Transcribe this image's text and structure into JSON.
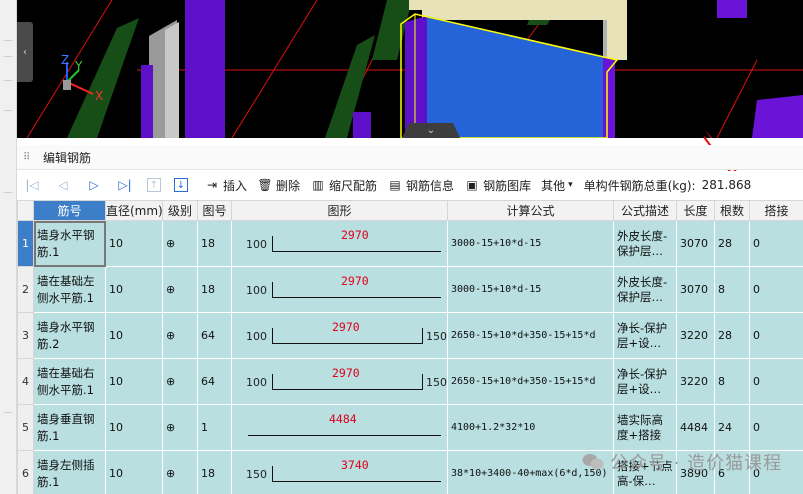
{
  "panel": {
    "title": "编辑钢筋"
  },
  "toolbar": {
    "insert": "插入",
    "delete": "删除",
    "scale_config": "缩尺配筋",
    "rebar_info": "钢筋信息",
    "rebar_library": "钢筋图库",
    "other": "其他",
    "total_label": "单构件钢筋总重(kg):",
    "total_value": "281.868"
  },
  "axes": {
    "x": "X",
    "y": "Y",
    "z": "Z"
  },
  "columns": [
    "筋号",
    "直径(mm)",
    "级别",
    "图号",
    "图形",
    "计算公式",
    "公式描述",
    "长度",
    "根数",
    "搭接"
  ],
  "rows": [
    {
      "no": "1",
      "name": "墙身水平钢筋.1",
      "dia": "10",
      "grade": "⊕",
      "fig": "18",
      "left": "100",
      "mid": "2970",
      "right": "",
      "formula": "3000-15+10*d-15",
      "desc1": "外皮长度-",
      "desc2": "保护层…",
      "len": "3070",
      "count": "28",
      "lap": "0"
    },
    {
      "no": "2",
      "name": "墙在基础左侧水平筋.1",
      "dia": "10",
      "grade": "⊕",
      "fig": "18",
      "left": "100",
      "mid": "2970",
      "right": "",
      "formula": "3000-15+10*d-15",
      "desc1": "外皮长度-",
      "desc2": "保护层…",
      "len": "3070",
      "count": "8",
      "lap": "0"
    },
    {
      "no": "3",
      "name": "墙身水平钢筋.2",
      "dia": "10",
      "grade": "⊕",
      "fig": "64",
      "left": "100",
      "mid": "2970",
      "right": "150",
      "formula": "2650-15+10*d+350-15+15*d",
      "desc1": "净长-保护",
      "desc2": "层+设…",
      "len": "3220",
      "count": "28",
      "lap": "0"
    },
    {
      "no": "4",
      "name": "墙在基础右侧水平筋.1",
      "dia": "10",
      "grade": "⊕",
      "fig": "64",
      "left": "100",
      "mid": "2970",
      "right": "150",
      "formula": "2650-15+10*d+350-15+15*d",
      "desc1": "净长-保护",
      "desc2": "层+设…",
      "len": "3220",
      "count": "8",
      "lap": "0"
    },
    {
      "no": "5",
      "name": "墙身垂直钢筋.1",
      "dia": "10",
      "grade": "⊕",
      "fig": "1",
      "left": "",
      "mid": "4484",
      "right": "",
      "formula": "4100+1.2*32*10",
      "desc1": "墙实际高",
      "desc2": "度+搭接",
      "len": "4484",
      "count": "24",
      "lap": "0"
    },
    {
      "no": "6",
      "name": "墙身左侧插筋.1",
      "dia": "10",
      "grade": "⊕",
      "fig": "18",
      "left": "150",
      "mid": "3740",
      "right": "",
      "formula": "38*10+3400-40+max(6*d,150)",
      "desc1": "搭接+节点",
      "desc2": "高-保…",
      "len": "3890",
      "count": "6",
      "lap": "0"
    }
  ],
  "watermark": "公众号 · 造价猫课程"
}
